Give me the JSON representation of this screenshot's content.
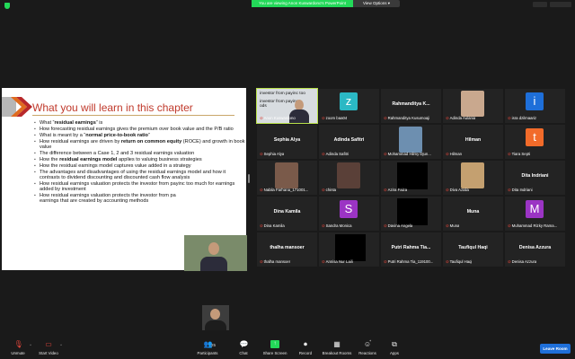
{
  "topbar": {
    "share_banner": "You are viewing Anon Kuswardono's PowerPoint",
    "view_options": "View Options ▾",
    "win_minimize": "",
    "win_fullscreen": ""
  },
  "slide": {
    "title": "What you will learn in this chapter",
    "bullets": [
      {
        "pre": "What “",
        "bold": "residual earnings",
        "post": "” is"
      },
      {
        "pre": "How forecasting residual earnings gives the premium over book value and the P/B ratio",
        "bold": "",
        "post": ""
      },
      {
        "pre": "What is meant by a “",
        "bold": "normal price-to-book ratio",
        "post": "”"
      },
      {
        "pre": "How residual earnings are driven by ",
        "bold": "return on common equity",
        "post": " (ROCE) and growth in book value"
      },
      {
        "pre": "The difference between a Case 1, 2 and 3 residual earnings valuation",
        "bold": "",
        "post": ""
      },
      {
        "pre": "How the ",
        "bold": "residual earnings model",
        "post": " applies to valuing business strategies"
      },
      {
        "pre": "How the residual earnings model captures value added in a strategy",
        "bold": "",
        "post": ""
      },
      {
        "pre": "The advantages and disadvantages of using the residual earnings model and how it contrasts to dividend discounting and discounted cash flow analysis",
        "bold": "",
        "post": ""
      },
      {
        "pre": "How residual earnings valuation protects the investor from payinc too much for earnings added by investment",
        "bold": "",
        "post": ""
      },
      {
        "pre": "How residual earnings valuation protects the investor from pa",
        "bold": "",
        "post": "earnings that are created by accounting methods"
      }
    ]
  },
  "gallery": {
    "tiles": [
      {
        "kind": "cam",
        "name": "",
        "label": "Anon Kuswardono",
        "cam_text_1": "investor from payinc too",
        "cam_text_2": "investor from paying",
        "cam_text_3": "ods",
        "active": true
      },
      {
        "kind": "avatar",
        "letter": "z",
        "color": "#2bb8c4",
        "name": "",
        "label": "zoom baa04",
        "active": false
      },
      {
        "kind": "name",
        "name": "Rahmanditya  K...",
        "label": "Rahmanditya Kusumoaji",
        "active": false
      },
      {
        "kind": "photo",
        "photo": "#c9a88e",
        "name": "",
        "label": "Adinda Aulania",
        "active": false
      },
      {
        "kind": "avatar",
        "letter": "i",
        "color": "#1e6fd9",
        "name": "",
        "label": "isra dzilmaariz",
        "active": false
      },
      {
        "kind": "name",
        "name": "Sephia Alya",
        "label": "Sephia Alya",
        "active": false
      },
      {
        "kind": "name",
        "name": "Adinda Safitri",
        "label": "Adinda Safitri",
        "active": false
      },
      {
        "kind": "photo",
        "photo": "#6d8fb0",
        "name": "",
        "label": "Mohammad Hilmy Djun...",
        "active": false
      },
      {
        "kind": "name",
        "name": "Hilman",
        "label": "Hilman",
        "active": false
      },
      {
        "kind": "avatar",
        "letter": "t",
        "color": "#f26b2a",
        "name": "",
        "label": "Tiara Septi",
        "active": false
      },
      {
        "kind": "photo",
        "photo": "#7a5a4a",
        "name": "",
        "label": "Nabila Farhana_171001...",
        "active": false
      },
      {
        "kind": "photo",
        "photo": "#5a4038",
        "name": "",
        "label": "chinta",
        "active": false
      },
      {
        "kind": "black",
        "name": "",
        "label": "Azira Faiza",
        "active": false
      },
      {
        "kind": "photo",
        "photo": "#c4a070",
        "name": "",
        "label": "Diva Azalia",
        "active": false
      },
      {
        "kind": "name",
        "name": "Dita Indriani",
        "label": "Dita Indriani",
        "active": false
      },
      {
        "kind": "name",
        "name": "Dina Kamila",
        "label": "Dina Kamila",
        "active": false
      },
      {
        "kind": "avatar",
        "letter": "S",
        "color": "#9b34c4",
        "name": "",
        "label": "Sandra Monica",
        "active": false
      },
      {
        "kind": "black",
        "name": "",
        "label": "Davina Angela",
        "active": false
      },
      {
        "kind": "name",
        "name": "Muna",
        "label": "Muna",
        "active": false
      },
      {
        "kind": "avatar",
        "letter": "M",
        "color": "#9b34c4",
        "name": "",
        "label": "Muhammad Rizky Rama...",
        "active": false
      },
      {
        "kind": "name",
        "name": "thalha mansoer",
        "label": "thalha mansoer",
        "active": false
      },
      {
        "kind": "black",
        "name": "",
        "label": "Annisa Nur Laili",
        "active": false
      },
      {
        "kind": "name",
        "name": "Putri Rahma Tia...",
        "label": "Putri Rahma Tia_119100...",
        "active": false
      },
      {
        "kind": "name",
        "name": "Taufiqul Haqi",
        "label": "Taufiqul Haqi",
        "active": false
      },
      {
        "kind": "name",
        "name": "Denisa Azzura",
        "label": "Denisa Azzura",
        "active": false
      }
    ]
  },
  "toolbar": {
    "unmute": "Unmute",
    "start_video": "Start Video",
    "participants": "Participants",
    "participants_count": "25",
    "chat": "Chat",
    "share_screen": "Share Screen",
    "record": "Record",
    "breakout_rooms": "Breakout Rooms",
    "reactions": "Reactions",
    "apps": "Apps",
    "leave_room": "Leave Room"
  },
  "colors": {
    "accent_green": "#23d959",
    "leave_blue": "#1e6fd9",
    "mute_red": "#e0463b",
    "slide_title_red": "#c0392b"
  }
}
